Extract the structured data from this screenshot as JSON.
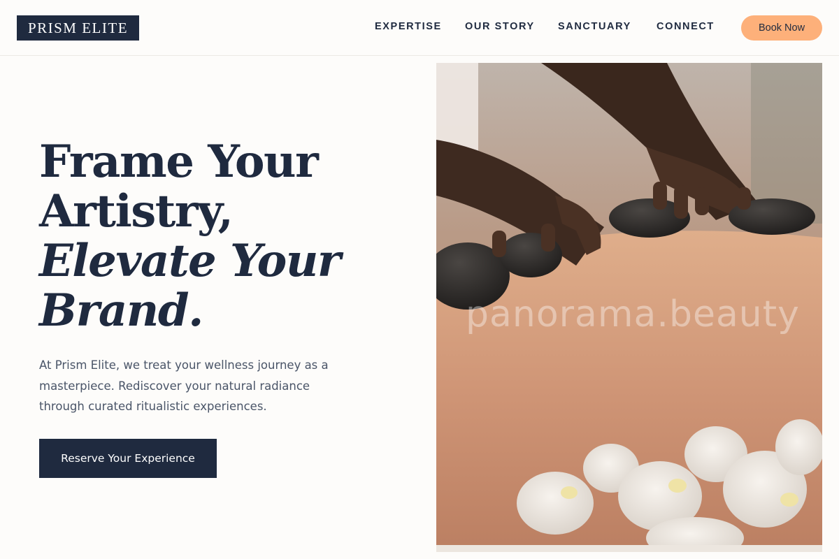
{
  "brand": {
    "name": "PRISM ELITE"
  },
  "nav": {
    "items": [
      {
        "label": "EXPERTISE"
      },
      {
        "label": "OUR STORY"
      },
      {
        "label": "SANCTUARY"
      },
      {
        "label": "CONNECT"
      }
    ],
    "cta_label": "Book Now"
  },
  "hero": {
    "headline_line1": "Frame Your",
    "headline_line2": "Artistry,",
    "headline_line3": "Elevate Your",
    "headline_line4": "Brand.",
    "intro": "At Prism Elite, we treat your wellness journey as a masterpiece. Rediscover your natural radiance through curated ritualistic experiences.",
    "cta_label": "Reserve Your Experience",
    "image_watermark": "panorama.beauty",
    "image_subject": "hot-stone-massage-photo"
  },
  "colors": {
    "navy": "#1f2a3f",
    "peach": "#fdb07a",
    "background": "#fdfcfa",
    "body_text": "#4a5568"
  }
}
